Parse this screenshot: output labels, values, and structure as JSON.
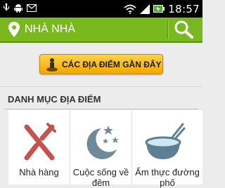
{
  "status_bar": {
    "time": "18:57",
    "left_icons": [
      "usb-icon",
      "android-debug-icon",
      "email-notification-icon"
    ],
    "right_icons": [
      "wifi-icon",
      "signal-icon",
      "battery-charging-icon"
    ]
  },
  "action_bar": {
    "title": "NHÀ NHÀ",
    "accent_color": "#79b81f"
  },
  "recent_button": {
    "label": "CÁC ĐỊA ĐIỂM GẦN ĐÂY",
    "icon": "person-location-icon"
  },
  "categories": {
    "title": "DANH MỤC ĐỊA ĐIỂM",
    "items": [
      {
        "label": "Nhà hàng",
        "icon": "fork-knife-icon"
      },
      {
        "label": "Cuộc sống về đêm",
        "icon": "moon-stars-icon"
      },
      {
        "label": "Ẩm thực đường phố",
        "icon": "noodle-bowl-icon"
      }
    ]
  }
}
